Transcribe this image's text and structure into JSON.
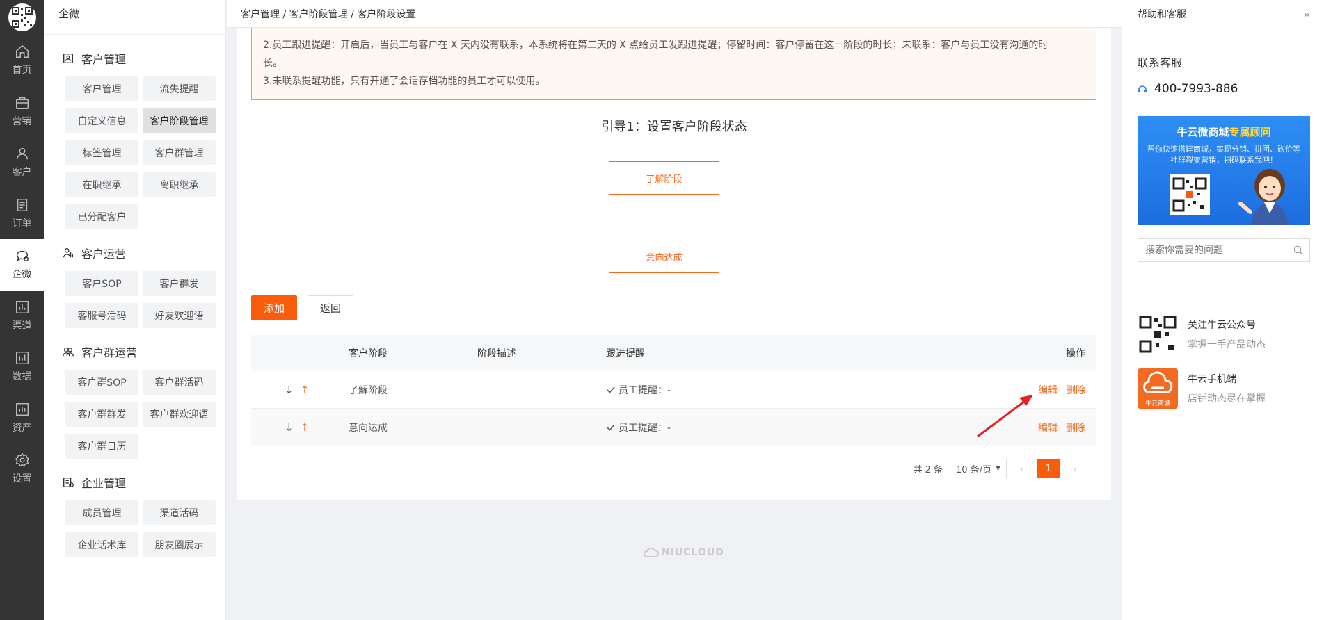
{
  "rail": {
    "items": [
      {
        "label": "首页",
        "icon": "home-icon"
      },
      {
        "label": "营销",
        "icon": "marketing-icon"
      },
      {
        "label": "客户",
        "icon": "customer-icon"
      },
      {
        "label": "订单",
        "icon": "order-icon"
      },
      {
        "label": "企微",
        "icon": "wecom-icon"
      },
      {
        "label": "渠道",
        "icon": "channel-icon"
      },
      {
        "label": "数据",
        "icon": "data-icon"
      },
      {
        "label": "资产",
        "icon": "asset-icon"
      },
      {
        "label": "设置",
        "icon": "settings-icon"
      }
    ],
    "active_index": 4
  },
  "sidebar": {
    "title": "企微",
    "groups": [
      {
        "title": "客户管理",
        "icon": "customer-card-icon",
        "buttons": [
          "客户管理",
          "流失提醒",
          "自定义信息",
          "客户阶段管理",
          "标签管理",
          "客户群管理",
          "在职继承",
          "离职继承",
          "已分配客户"
        ]
      },
      {
        "title": "客户运营",
        "icon": "customer-ops-icon",
        "buttons": [
          "客户SOP",
          "客户群发",
          "客服号活码",
          "好友欢迎语"
        ]
      },
      {
        "title": "客户群运营",
        "icon": "group-ops-icon",
        "buttons": [
          "客户群SOP",
          "客户群活码",
          "客户群群发",
          "客户群欢迎语",
          "客户群日历"
        ]
      },
      {
        "title": "企业管理",
        "icon": "enterprise-icon",
        "buttons": [
          "成员管理",
          "渠道活码",
          "企业话术库",
          "朋友圈展示"
        ]
      }
    ],
    "active_button": "客户阶段管理"
  },
  "header": {
    "breadcrumb": "客户管理 / 客户阶段管理 / 客户阶段设置"
  },
  "notice": {
    "line1": "2.员工跟进提醒：开启后，当员工与客户在 X 天内没有联系，本系统将在第二天的 X 点给员工发跟进提醒；停留时间：客户停留在这一阶段的时长；未联系：客户与员工没有沟通的时",
    "line1b": "长。",
    "line2": "3.未联系提醒功能，只有开通了会话存档功能的员工才可以使用。"
  },
  "guide": {
    "title": "引导1：设置客户阶段状态",
    "steps": [
      "了解阶段",
      "意向达成"
    ]
  },
  "actions": {
    "add": "添加",
    "back": "返回"
  },
  "table": {
    "headers": {
      "stage": "客户阶段",
      "desc": "阶段描述",
      "remind": "跟进提醒",
      "ops": "操作"
    },
    "rows": [
      {
        "stage": "了解阶段",
        "desc": "",
        "remind": "员工提醒：-",
        "edit": "编辑",
        "delete": "删除"
      },
      {
        "stage": "意向达成",
        "desc": "",
        "remind": "员工提醒：-",
        "edit": "编辑",
        "delete": "删除"
      }
    ],
    "sort_down": "↓",
    "sort_up": "↑"
  },
  "pagination": {
    "total": "共 2 条",
    "page_size": "10 条/页",
    "current_page": "1"
  },
  "footer": {
    "logo_text": "NIUCLOUD"
  },
  "help": {
    "title": "帮助和客服",
    "contact_title": "联系客服",
    "phone": "400-7993-886",
    "banner": {
      "title_a": "牛云微商城",
      "title_b": "专属顾问",
      "subtitle": "帮你快速搭建商城，实现分销、拼团、砍价等社群裂变营销，扫码联系我吧！"
    },
    "search_placeholder": "搜索你需要的问题",
    "promos": [
      {
        "title": "关注牛云公众号",
        "subtitle": "掌握一手产品动态"
      },
      {
        "title": "牛云手机端",
        "subtitle": "店铺动态尽在掌握",
        "badge": "牛云商城"
      }
    ]
  },
  "colors": {
    "accent": "#f95c0b",
    "rail_bg": "#343434",
    "link": "#f26b21"
  }
}
